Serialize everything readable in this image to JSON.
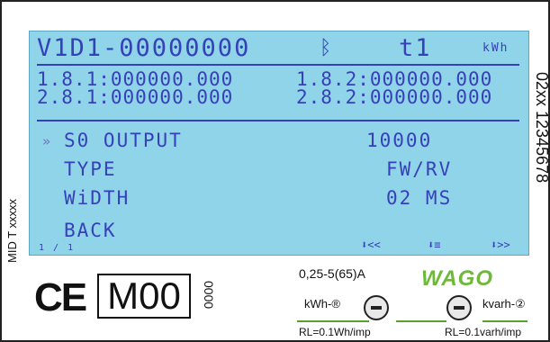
{
  "lcd": {
    "version": "V1D1-00000000",
    "bluetooth_icon": "bluetooth-icon",
    "tariff": "t1",
    "unit": "kWh",
    "reg_181": "1.8.1:000000.000",
    "reg_182": "1.8.2:000000.000",
    "reg_281": "2.8.1:000000.000",
    "reg_282": "2.8.2:000000.000",
    "cursor": "»",
    "menu": [
      {
        "label": "S0 OUTPUT",
        "value": "10000"
      },
      {
        "label": "TYPE",
        "value": "FW/RV"
      },
      {
        "label": "WiDTH",
        "value": "02 MS"
      },
      {
        "label": "BACK",
        "value": ""
      }
    ],
    "page_indicator": "1 / 1",
    "nav_prev": "⬇<<",
    "nav_menu": "⬇≡",
    "nav_next": "⬇>>"
  },
  "side_right": "02xx 12345678",
  "side_left": "MID T xxxxx",
  "labels": {
    "ce": "CE",
    "m00": "M00",
    "small_number": "0000",
    "current": "0,25-5(65)A",
    "wago": "WAGO",
    "kwh_led": "kWh-®",
    "kvarh_led": "kvarh-②",
    "rl_kwh": "RL=0.1Wh/imp",
    "rl_kvarh": "RL=0.1varh/imp"
  },
  "colors": {
    "lcd_background": "#8fd4e8",
    "lcd_text": "#3640b8",
    "wago_green": "#6fb93a"
  }
}
